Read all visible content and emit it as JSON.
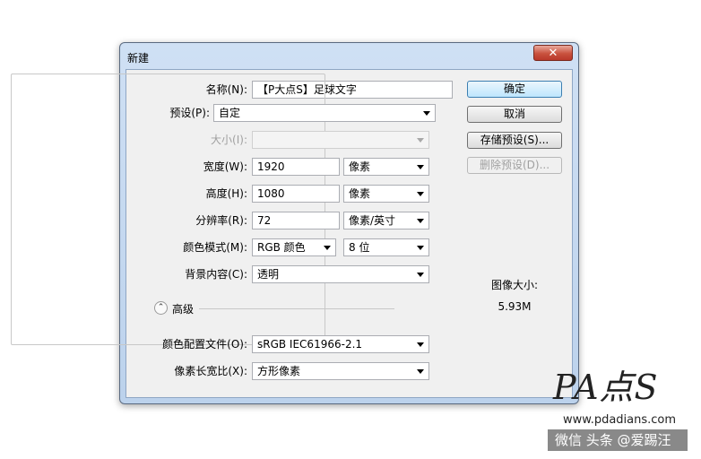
{
  "window": {
    "title": "新建",
    "close_glyph": "✕"
  },
  "fields": {
    "name": {
      "label": "名称(N):",
      "value": "【P大点S】足球文字"
    },
    "preset": {
      "label": "预设(P):",
      "value": "自定"
    },
    "size": {
      "label": "大小(I):",
      "value": ""
    },
    "width": {
      "label": "宽度(W):",
      "value": "1920",
      "unit": "像素"
    },
    "height": {
      "label": "高度(H):",
      "value": "1080",
      "unit": "像素"
    },
    "resolution": {
      "label": "分辨率(R):",
      "value": "72",
      "unit": "像素/英寸"
    },
    "color_mode": {
      "label": "颜色模式(M):",
      "value": "RGB 颜色",
      "depth": "8 位"
    },
    "background": {
      "label": "背景内容(C):",
      "value": "透明"
    },
    "advanced": {
      "label": "高级",
      "icon": "collapse-up-icon",
      "glyph": "⌃"
    },
    "color_profile": {
      "label": "颜色配置文件(O):",
      "value": "sRGB IEC61966-2.1"
    },
    "pixel_aspect": {
      "label": "像素长宽比(X):",
      "value": "方形像素"
    }
  },
  "buttons": {
    "ok": "确定",
    "cancel": "取消",
    "save_preset": "存储预设(S)...",
    "delete_preset": "删除预设(D)..."
  },
  "image_size": {
    "label": "图像大小:",
    "value": "5.93M"
  },
  "watermark": {
    "logo_text": "PA点S",
    "url": "www.pdadians.com",
    "credit": "微信 头条 @爱踢汪"
  },
  "colors": {
    "titlebar": "#cfe0f4",
    "close_button": "#c9523e",
    "default_button": "#bee6fd",
    "client_bg": "#f0f0f0"
  }
}
